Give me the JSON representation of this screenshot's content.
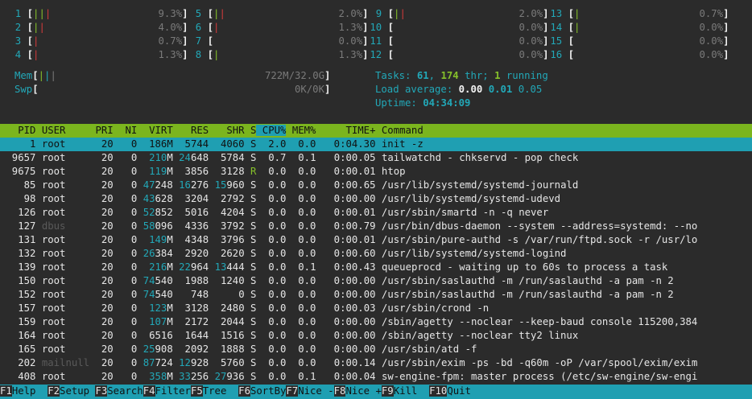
{
  "cpus": [
    {
      "id": "1",
      "pct": "9.3%",
      "bars": [
        [
          "green",
          "|"
        ],
        [
          "green",
          "|"
        ],
        [
          "red",
          "|"
        ]
      ]
    },
    {
      "id": "2",
      "pct": "4.0%",
      "bars": [
        [
          "green",
          "|"
        ],
        [
          "red",
          "|"
        ]
      ]
    },
    {
      "id": "3",
      "pct": "0.7%",
      "bars": [
        [
          "red",
          "|"
        ]
      ]
    },
    {
      "id": "4",
      "pct": "1.3%",
      "bars": [
        [
          "red",
          "|"
        ]
      ]
    },
    {
      "id": "5",
      "pct": "2.0%",
      "bars": [
        [
          "green",
          "|"
        ],
        [
          "red",
          "|"
        ]
      ]
    },
    {
      "id": "6",
      "pct": "1.3%",
      "bars": [
        [
          "red",
          "|"
        ]
      ]
    },
    {
      "id": "7",
      "pct": "0.0%",
      "bars": []
    },
    {
      "id": "8",
      "pct": "1.3%",
      "bars": [
        [
          "green",
          "|"
        ]
      ]
    },
    {
      "id": "9",
      "pct": "2.0%",
      "bars": [
        [
          "green",
          "|"
        ],
        [
          "red",
          "|"
        ]
      ]
    },
    {
      "id": "10",
      "pct": "0.0%",
      "bars": []
    },
    {
      "id": "11",
      "pct": "0.0%",
      "bars": []
    },
    {
      "id": "12",
      "pct": "0.0%",
      "bars": []
    },
    {
      "id": "13",
      "pct": "0.7%",
      "bars": [
        [
          "green",
          "|"
        ]
      ]
    },
    {
      "id": "14",
      "pct": "0.0%",
      "bars": [
        [
          "green",
          "|"
        ]
      ]
    },
    {
      "id": "15",
      "pct": "0.0%",
      "bars": []
    },
    {
      "id": "16",
      "pct": "0.0%",
      "bars": []
    }
  ],
  "mem": {
    "label": "Mem",
    "value": "722M/32.0G"
  },
  "swp": {
    "label": "Swp",
    "value": "0K/0K"
  },
  "tasks": {
    "label": "Tasks: ",
    "count": "61",
    "sep": ", ",
    "thr": "174",
    "thr_label": " thr; ",
    "running": "1",
    "running_label": " running"
  },
  "load": {
    "label": "Load average: ",
    "v1": "0.00",
    "v5": "0.01",
    "v15": "0.05"
  },
  "uptime": {
    "label": "Uptime: ",
    "value": "04:34:09"
  },
  "columns": [
    "PID",
    "USER",
    "PRI",
    "NI",
    "VIRT",
    "RES",
    "SHR",
    "S",
    "CPU%",
    "MEM%",
    "TIME+",
    "Command"
  ],
  "processes": [
    {
      "pid": "1",
      "user": "root",
      "pri": "20",
      "ni": "0",
      "virt": "186M",
      "res": "5744",
      "shr": "4060",
      "s": "S",
      "cpu": "2.0",
      "mem": "0.0",
      "time": "0:04.30",
      "cmd": "init -z"
    },
    {
      "pid": "9657",
      "user": "root",
      "pri": "20",
      "ni": "0",
      "virt": "210M",
      "res": "24648",
      "shr": "5784",
      "s": "S",
      "cpu": "0.7",
      "mem": "0.1",
      "time": "0:00.05",
      "cmd": "tailwatchd - chkservd - pop check"
    },
    {
      "pid": "9675",
      "user": "root",
      "pri": "20",
      "ni": "0",
      "virt": "119M",
      "res": "3856",
      "shr": "3128",
      "s": "R",
      "cpu": "0.0",
      "mem": "0.0",
      "time": "0:00.01",
      "cmd": "htop"
    },
    {
      "pid": "85",
      "user": "root",
      "pri": "20",
      "ni": "0",
      "virt": "47248",
      "res": "16276",
      "shr": "15960",
      "s": "S",
      "cpu": "0.0",
      "mem": "0.0",
      "time": "0:00.65",
      "cmd": "/usr/lib/systemd/systemd-journald"
    },
    {
      "pid": "98",
      "user": "root",
      "pri": "20",
      "ni": "0",
      "virt": "43628",
      "res": "3204",
      "shr": "2792",
      "s": "S",
      "cpu": "0.0",
      "mem": "0.0",
      "time": "0:00.00",
      "cmd": "/usr/lib/systemd/systemd-udevd"
    },
    {
      "pid": "126",
      "user": "root",
      "pri": "20",
      "ni": "0",
      "virt": "52852",
      "res": "5016",
      "shr": "4204",
      "s": "S",
      "cpu": "0.0",
      "mem": "0.0",
      "time": "0:00.01",
      "cmd": "/usr/sbin/smartd -n -q never"
    },
    {
      "pid": "127",
      "user": "dbus",
      "pri": "20",
      "ni": "0",
      "virt": "58096",
      "res": "4336",
      "shr": "3792",
      "s": "S",
      "cpu": "0.0",
      "mem": "0.0",
      "time": "0:00.79",
      "cmd": "/usr/bin/dbus-daemon --system --address=systemd: --no"
    },
    {
      "pid": "131",
      "user": "root",
      "pri": "20",
      "ni": "0",
      "virt": "149M",
      "res": "4348",
      "shr": "3796",
      "s": "S",
      "cpu": "0.0",
      "mem": "0.0",
      "time": "0:00.01",
      "cmd": "/usr/sbin/pure-authd -s /var/run/ftpd.sock -r /usr/lo"
    },
    {
      "pid": "132",
      "user": "root",
      "pri": "20",
      "ni": "0",
      "virt": "26384",
      "res": "2920",
      "shr": "2620",
      "s": "S",
      "cpu": "0.0",
      "mem": "0.0",
      "time": "0:00.60",
      "cmd": "/usr/lib/systemd/systemd-logind"
    },
    {
      "pid": "139",
      "user": "root",
      "pri": "20",
      "ni": "0",
      "virt": "216M",
      "res": "22964",
      "shr": "13444",
      "s": "S",
      "cpu": "0.0",
      "mem": "0.1",
      "time": "0:00.43",
      "cmd": "queueprocd - waiting up to 60s to process a task"
    },
    {
      "pid": "150",
      "user": "root",
      "pri": "20",
      "ni": "0",
      "virt": "74540",
      "res": "1988",
      "shr": "1240",
      "s": "S",
      "cpu": "0.0",
      "mem": "0.0",
      "time": "0:00.00",
      "cmd": "/usr/sbin/saslauthd -m /run/saslauthd -a pam -n 2"
    },
    {
      "pid": "152",
      "user": "root",
      "pri": "20",
      "ni": "0",
      "virt": "74540",
      "res": "748",
      "shr": "0",
      "s": "S",
      "cpu": "0.0",
      "mem": "0.0",
      "time": "0:00.00",
      "cmd": "/usr/sbin/saslauthd -m /run/saslauthd -a pam -n 2"
    },
    {
      "pid": "157",
      "user": "root",
      "pri": "20",
      "ni": "0",
      "virt": "123M",
      "res": "3128",
      "shr": "2480",
      "s": "S",
      "cpu": "0.0",
      "mem": "0.0",
      "time": "0:00.03",
      "cmd": "/usr/sbin/crond -n"
    },
    {
      "pid": "159",
      "user": "root",
      "pri": "20",
      "ni": "0",
      "virt": "107M",
      "res": "2172",
      "shr": "2044",
      "s": "S",
      "cpu": "0.0",
      "mem": "0.0",
      "time": "0:00.00",
      "cmd": "/sbin/agetty --noclear --keep-baud console 115200,384"
    },
    {
      "pid": "164",
      "user": "root",
      "pri": "20",
      "ni": "0",
      "virt": "6516",
      "res": "1644",
      "shr": "1516",
      "s": "S",
      "cpu": "0.0",
      "mem": "0.0",
      "time": "0:00.00",
      "cmd": "/sbin/agetty --noclear tty2 linux"
    },
    {
      "pid": "165",
      "user": "root",
      "pri": "20",
      "ni": "0",
      "virt": "25908",
      "res": "2092",
      "shr": "1888",
      "s": "S",
      "cpu": "0.0",
      "mem": "0.0",
      "time": "0:00.00",
      "cmd": "/usr/sbin/atd -f"
    },
    {
      "pid": "202",
      "user": "mailnull",
      "pri": "20",
      "ni": "0",
      "virt": "87724",
      "res": "12928",
      "shr": "5760",
      "s": "S",
      "cpu": "0.0",
      "mem": "0.0",
      "time": "0:00.14",
      "cmd": "/usr/sbin/exim -ps -bd -q60m -oP /var/spool/exim/exim"
    },
    {
      "pid": "408",
      "user": "root",
      "pri": "20",
      "ni": "0",
      "virt": "358M",
      "res": "33256",
      "shr": "27936",
      "s": "S",
      "cpu": "0.0",
      "mem": "0.1",
      "time": "0:00.04",
      "cmd": "sw-engine-fpm: master process (/etc/sw-engine/sw-engi"
    }
  ],
  "fkeys": [
    {
      "key": "F1",
      "label": "Help  "
    },
    {
      "key": "F2",
      "label": "Setup "
    },
    {
      "key": "F3",
      "label": "Search"
    },
    {
      "key": "F4",
      "label": "Filter"
    },
    {
      "key": "F5",
      "label": "Tree  "
    },
    {
      "key": "F6",
      "label": "SortBy"
    },
    {
      "key": "F7",
      "label": "Nice -"
    },
    {
      "key": "F8",
      "label": "Nice +"
    },
    {
      "key": "F9",
      "label": "Kill  "
    },
    {
      "key": "F10",
      "label": "Quit"
    }
  ],
  "colors": {
    "background": "#2b2b2b",
    "header": "#7bb51e",
    "selection": "#1f9fb2",
    "cyan": "#22a8b8",
    "green": "#86c02a",
    "red": "#d23b3b"
  }
}
